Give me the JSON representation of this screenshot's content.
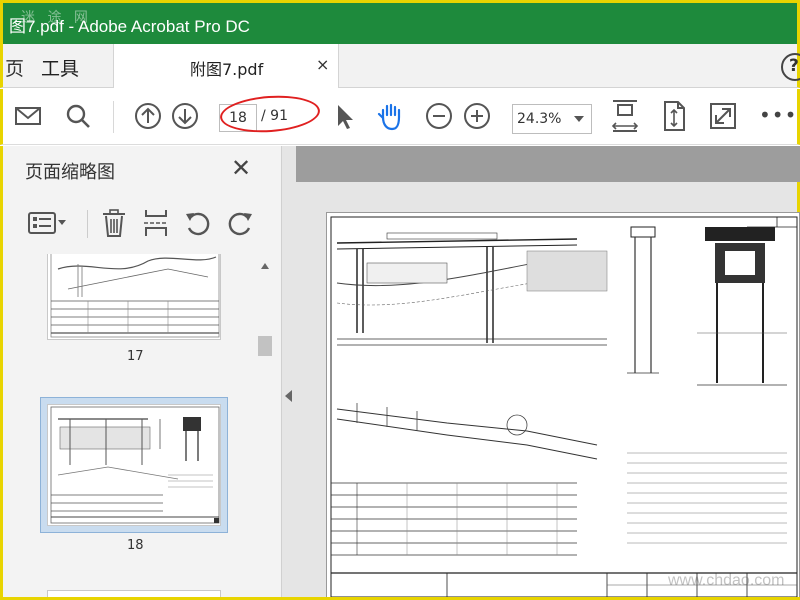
{
  "titlebar": {
    "title": "图7.pdf - Adobe Acrobat Pro DC",
    "watermark": "迷 途 网"
  },
  "tabs": {
    "partial_label": "页",
    "tools_label": "工具",
    "document_tab": "附图7.pdf",
    "close_glyph": "×",
    "help_glyph": "?"
  },
  "toolbar": {
    "icons": [
      "mail-icon",
      "search-icon",
      "page-up-icon",
      "page-down-icon",
      "select-arrow-icon",
      "hand-tool-icon",
      "zoom-out-icon",
      "zoom-in-icon",
      "fit-page-icon",
      "scroll-mode-icon",
      "full-screen-icon",
      "more-icon"
    ],
    "current_page": "18",
    "total_pages": "/ 91",
    "zoom": "24.3%",
    "more_glyph": "•••"
  },
  "panel": {
    "title": "页面缩略图",
    "close_glyph": "✕",
    "tools": [
      "thumbnail-options-icon",
      "delete-page-icon",
      "extract-page-icon",
      "rotate-ccw-icon",
      "rotate-cw-icon"
    ],
    "thumbnails": [
      {
        "label": "17",
        "selected": false
      },
      {
        "label": "18",
        "selected": true
      }
    ]
  },
  "document": {
    "website_watermark": "www.chdao.com"
  },
  "colors": {
    "titlebar": "#1e8a3c",
    "hand_tool": "#1a73e8",
    "annotation": "#e02020",
    "frame": "#e8d400"
  }
}
